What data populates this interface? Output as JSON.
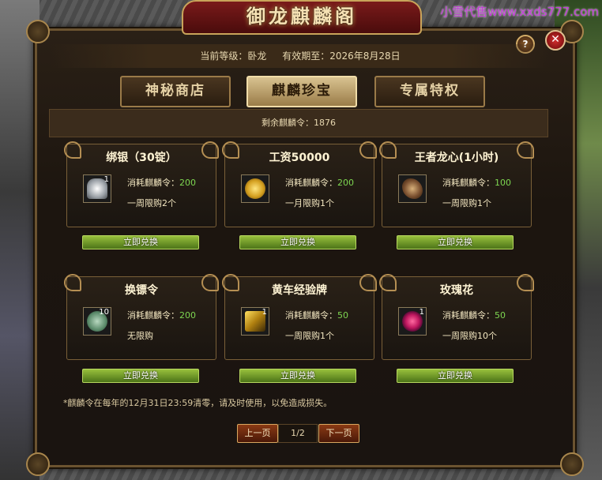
{
  "watermark": "小雪代售www.xxds777.com",
  "window": {
    "title": "御龙麒麟阁"
  },
  "header": {
    "level_label": "当前等级：卧龙",
    "expire_label": "有效期至：2026年8月28日"
  },
  "tabs": [
    {
      "label": "神秘商店",
      "active": false
    },
    {
      "label": "麒麟珍宝",
      "active": true
    },
    {
      "label": "专属特权",
      "active": false
    }
  ],
  "remain": {
    "label": "剩余麒麟令：1876"
  },
  "cost_prefix": "消耗麒麟令：",
  "redeem_label": "立即兑换",
  "items": [
    {
      "name": "绑银（30锭）",
      "icon": "silver-ingot-icon",
      "count": "1",
      "cost": "200",
      "limit": "一周限购2个"
    },
    {
      "name": "工资50000",
      "icon": "gold-coins-icon",
      "count": "",
      "cost": "200",
      "limit": "一月限购1个"
    },
    {
      "name": "王者龙心(1小时)",
      "icon": "dragon-head-icon",
      "count": "",
      "cost": "100",
      "limit": "一周限购1个"
    },
    {
      "name": "换镖令",
      "icon": "token-icon",
      "count": "10",
      "cost": "200",
      "limit": "无限购"
    },
    {
      "name": "黄车经验牌",
      "icon": "golden-cart-icon",
      "count": "1",
      "cost": "50",
      "limit": "一周限购1个"
    },
    {
      "name": "玫瑰花",
      "icon": "rose-icon",
      "count": "1",
      "cost": "50",
      "limit": "一周限购10个"
    }
  ],
  "footnote": "*麒麟令在每年的12月31日23:59清零，请及时使用，以免造成损失。",
  "pager": {
    "prev": "上一页",
    "page": "1/2",
    "next": "下一页"
  },
  "help_label": "?",
  "close_label": "✕",
  "colors": {
    "accent_gold": "#c9a45a",
    "value_green": "#7ed651",
    "button_green": "#6e9a28"
  }
}
